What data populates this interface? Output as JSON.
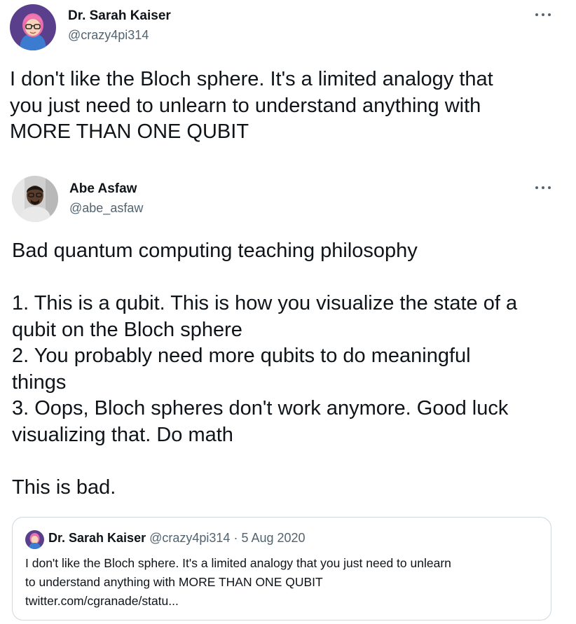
{
  "colors": {
    "text": "#0f1419",
    "secondary": "#536471",
    "border": "#cfd9de",
    "avatar1_bg": "#5a3f8c",
    "avatar2_bg": "#cfcfcf"
  },
  "tweet1": {
    "name": "Dr. Sarah Kaiser",
    "handle": "@crazy4pi314",
    "more_icon": "more-horizontal-icon",
    "text_lines": [
      "I don't like the Bloch sphere. It's a limited analogy that",
      "you just need to unlearn to understand anything with",
      "MORE THAN ONE QUBIT"
    ]
  },
  "tweet2": {
    "name": "Abe Asfaw",
    "handle": "@abe_asfaw",
    "more_icon": "more-horizontal-icon",
    "text_lines": [
      "Bad quantum computing teaching philosophy",
      "",
      "1. This is a qubit. This is how you visualize the state of a",
      "qubit on the Bloch sphere",
      "2. You probably need more qubits to do meaningful",
      "things",
      "3. Oops, Bloch spheres don't work anymore. Good luck",
      "visualizing that. Do math",
      "",
      "This is bad."
    ]
  },
  "quote": {
    "name": "Dr. Sarah Kaiser",
    "handle": "@crazy4pi314",
    "separator": " · ",
    "date": "5 Aug 2020",
    "lines": [
      "I don't like the Bloch sphere. It's a limited analogy that you just need to unlearn",
      "to understand anything with MORE THAN ONE QUBIT",
      "twitter.com/cgranade/statu..."
    ]
  }
}
